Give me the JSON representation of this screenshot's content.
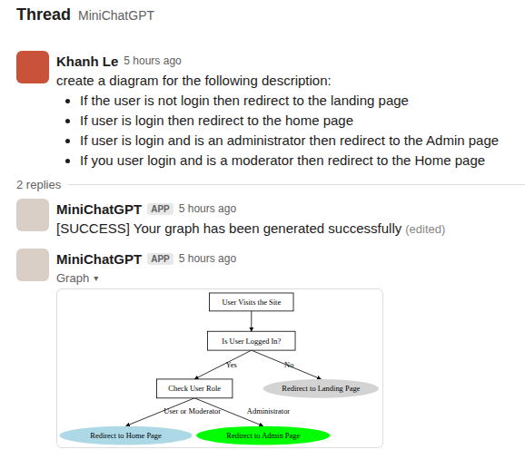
{
  "thread": {
    "title": "Thread",
    "channel": "MiniChatGPT"
  },
  "question": {
    "author": "Khanh Le",
    "time": "5 hours ago",
    "text": "create a diagram for the following description:",
    "bullets": [
      "If the user is not login then redirect to the landing page",
      "If user is login then redirect to the home page",
      "If user is login and is an administrator then redirect to the Admin page",
      "If you user login and is a moderator then redirect to the Home page"
    ]
  },
  "replies_divider": "2 replies",
  "replies": [
    {
      "author": "MiniChatGPT",
      "badge": "APP",
      "time": "5 hours ago",
      "kind": "text",
      "text": "[SUCCESS] Your graph has been generated successfully",
      "edited": "(edited)"
    },
    {
      "author": "MiniChatGPT",
      "badge": "APP",
      "time": "5 hours ago",
      "kind": "attachment",
      "label": "Graph",
      "caret": "▾"
    }
  ],
  "graph": {
    "nodes": [
      {
        "label": "User Visits the Site",
        "kind": "box",
        "color": "#ffffff"
      },
      {
        "label": "Is User Logged In?",
        "kind": "box",
        "color": "#ffffff"
      },
      {
        "label": "Check User Role",
        "kind": "box",
        "color": "#ffffff"
      },
      {
        "label": "Redirect to Landing Page",
        "kind": "ellipse",
        "color": "#d3d3d3"
      },
      {
        "label": "Redirect to Home Page",
        "kind": "ellipse",
        "color": "#add8e6"
      },
      {
        "label": "Redirect to Admin Page",
        "kind": "ellipse",
        "color": "#00ff00"
      }
    ],
    "edges": [
      {
        "from": 0,
        "to": 1
      },
      {
        "from": 1,
        "to": 2,
        "label": "Yes"
      },
      {
        "from": 1,
        "to": 3,
        "label": "No"
      },
      {
        "from": 2,
        "to": 4,
        "label": "User or Moderator"
      },
      {
        "from": 2,
        "to": 5,
        "label": "Administrator"
      }
    ]
  }
}
